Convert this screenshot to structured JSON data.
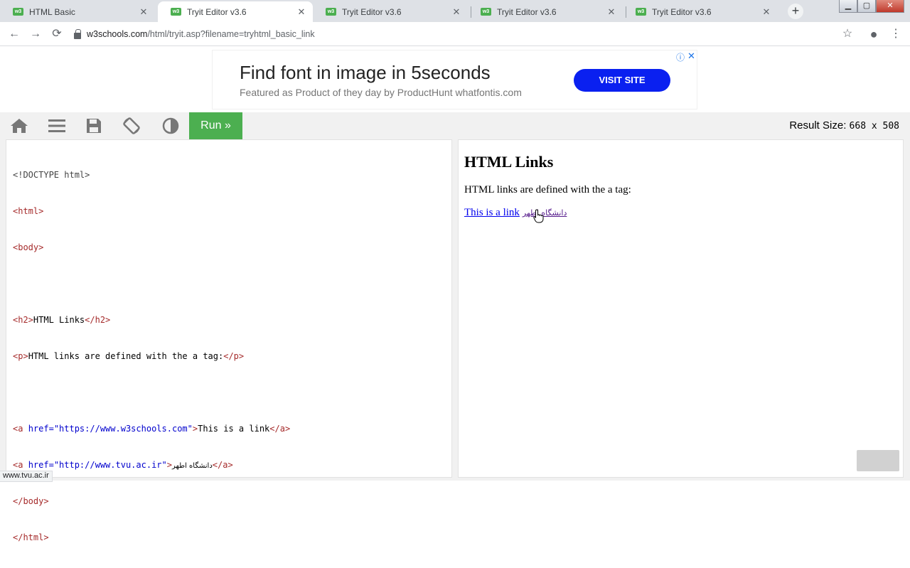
{
  "tabs": [
    {
      "title": "HTML Basic",
      "active": false
    },
    {
      "title": "Tryit Editor v3.6",
      "active": true
    },
    {
      "title": "Tryit Editor v3.6",
      "active": false
    },
    {
      "title": "Tryit Editor v3.6",
      "active": false
    },
    {
      "title": "Tryit Editor v3.6",
      "active": false
    }
  ],
  "favicon_text": "w3",
  "address": {
    "host": "w3schools.com",
    "path": "/html/tryit.asp?filename=tryhtml_basic_link"
  },
  "ad": {
    "headline": "Find font in image in 5seconds",
    "subline": "Featured as Product of they day by ProductHunt whatfontis.com",
    "button": "VISIT SITE"
  },
  "tryit": {
    "run_label": "Run »",
    "result_size_label": "Result Size:",
    "result_size_value": "668 x 508"
  },
  "code_lines": [
    "<!DOCTYPE html>",
    "<html>",
    "<body>",
    "",
    "<h2>HTML Links</h2>",
    "<p>HTML links are defined with the a tag:</p>",
    "",
    "<a href=\"https://www.w3schools.com\">This is a link</a>",
    "<a href=\"http://www.tvu.ac.ir\">دانشگاه اطهر</a>",
    "</body>",
    "</html>"
  ],
  "code_parts": {
    "doctype": "<!DOCTYPE html>",
    "html_open": "<html>",
    "body_open": "<body>",
    "h2_open": "<h2>",
    "h2_text": "HTML Links",
    "h2_close": "</h2>",
    "p_open": "<p>",
    "p_text": "HTML links are defined with the a tag:",
    "p_close": "</p>",
    "a_open": "<a ",
    "href_attr": "href=",
    "href1": "\"https://www.w3schools.com\"",
    "gt": ">",
    "a1_text": "This is a link",
    "a_close": "</a>",
    "href2": "\"http://www.tvu.ac.ir\"",
    "a2_text": "دانشگاه اطهر",
    "body_close": "</body>",
    "html_close": "</html>"
  },
  "result": {
    "heading": "HTML Links",
    "paragraph": "HTML links are defined with the a tag:",
    "link1": "This is a link",
    "link2": "دانشگاه اطهر"
  },
  "status_url": "www.tvu.ac.ir",
  "colors": {
    "run_green": "#4caf50",
    "ad_button": "#0a20f0",
    "tag": "#a52a2a",
    "attr": "#0000cd"
  }
}
